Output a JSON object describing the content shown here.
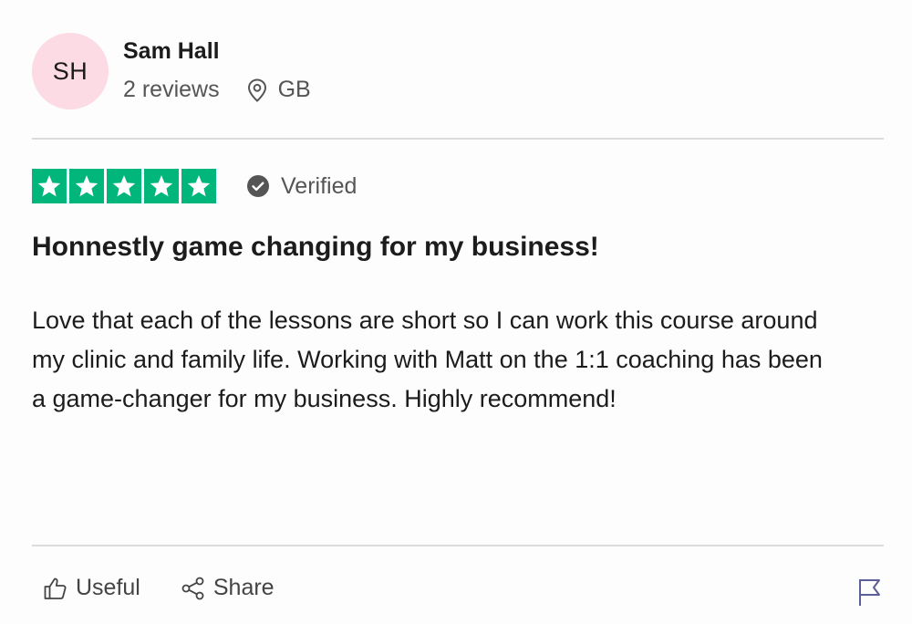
{
  "reviewer": {
    "initials": "SH",
    "name": "Sam Hall",
    "reviews": "2 reviews",
    "location": "GB",
    "avatar_color": "#fcdbe4"
  },
  "rating": {
    "stars": 5,
    "star_color": "#00b67a",
    "verified_label": "Verified"
  },
  "review": {
    "title": "Honnestly game changing for my business!",
    "body": "Love that each of the lessons are short so I can work this course around my clinic and family life. Working with Matt on the 1:1 coaching has been a game-changer for my business. Highly recommend!"
  },
  "actions": {
    "useful_label": "Useful",
    "share_label": "Share",
    "icons": [
      "thumbs-up-icon",
      "share-icon",
      "flag-icon"
    ]
  }
}
